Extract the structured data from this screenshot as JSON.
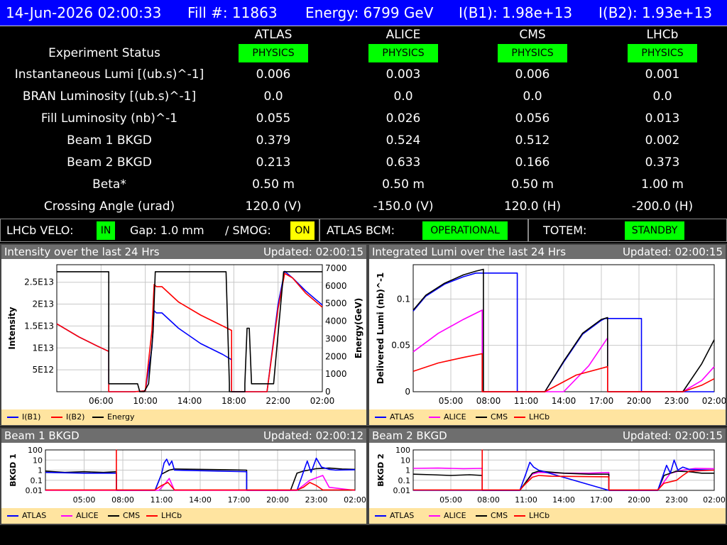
{
  "header": {
    "datetime": "14-Jun-2026 02:00:33",
    "fill": "Fill #: 11863",
    "energy": "Energy: 6799 GeV",
    "ib1": "I(B1): 1.98e+13",
    "ib2": "I(B2): 1.93e+13"
  },
  "experiments": [
    "ATLAS",
    "ALICE",
    "CMS",
    "LHCb"
  ],
  "status_label": "Experiment Status",
  "statuses": [
    "PHYSICS",
    "PHYSICS",
    "PHYSICS",
    "PHYSICS"
  ],
  "rows": [
    {
      "label": "Instantaneous Lumi [(ub.s)^-1]",
      "values": [
        "0.006",
        "0.003",
        "0.006",
        "0.001"
      ]
    },
    {
      "label": "BRAN Luminosity [(ub.s)^-1]",
      "values": [
        "0.0",
        "0.0",
        "0.0",
        "0.0"
      ]
    },
    {
      "label": "Fill Luminosity (nb)^-1",
      "values": [
        "0.055",
        "0.026",
        "0.056",
        "0.013"
      ]
    },
    {
      "label": "Beam 1 BKGD",
      "values": [
        "0.379",
        "0.524",
        "0.512",
        "0.002"
      ]
    },
    {
      "label": "Beam 2 BKGD",
      "values": [
        "0.213",
        "0.633",
        "0.166",
        "0.373"
      ]
    },
    {
      "label": "Beta*",
      "values": [
        "0.50 m",
        "0.50 m",
        "0.50 m",
        "1.00 m"
      ]
    },
    {
      "label": "Crossing Angle (urad)",
      "values": [
        "120.0 (V)",
        "-150.0 (V)",
        "120.0 (H)",
        "-200.0 (H)"
      ]
    }
  ],
  "subbar": {
    "velo_label": "LHCb VELO:",
    "velo_value": "IN",
    "gap": "Gap: 1.0 mm",
    "smog_label": "/ SMOG:",
    "smog_value": "ON",
    "bcm_label": "ATLAS BCM:",
    "bcm_value": "OPERATIONAL",
    "totem_label": "TOTEM:",
    "totem_value": "STANDBY"
  },
  "colors": {
    "header_bg": "#0000ff",
    "ok_green": "#00ff00",
    "on_yellow": "#ffff00",
    "atlas": "#0000ff",
    "alice": "#ff00ff",
    "cms": "#000000",
    "lhcb": "#ff0000",
    "legend_bg": "#ffe4a0",
    "panel_title": "#6e6e6e"
  },
  "panels": {
    "intensity": {
      "title": "Intensity over the last 24 Hrs",
      "updated": "Updated: 02:00:15",
      "legend": [
        "I(B1)",
        "I(B2)",
        "Energy"
      ]
    },
    "lumi": {
      "title": "Integrated Lumi over the last 24 Hrs",
      "updated": "Updated: 02:00:15",
      "legend": [
        "ATLAS",
        "ALICE",
        "CMS",
        "LHCb"
      ]
    },
    "bkgd1": {
      "title": "Beam 1 BKGD",
      "updated": "Updated: 02:00:12",
      "legend": [
        "ATLAS",
        "ALICE",
        "CMS",
        "LHCb"
      ]
    },
    "bkgd2": {
      "title": "Beam 2 BKGD",
      "updated": "Updated: 02:00:15",
      "legend": [
        "ATLAS",
        "ALICE",
        "CMS",
        "LHCb"
      ]
    }
  },
  "chart_data": [
    {
      "type": "line",
      "title": "Intensity over the last 24 Hrs",
      "ylabel": "Intensity",
      "y2label": "Energy(GeV)",
      "xlim": [
        2.0,
        26.0
      ],
      "xticks": [
        6,
        10,
        14,
        18,
        22,
        26
      ],
      "xticklabels": [
        "06:00",
        "10:00",
        "14:00",
        "18:00",
        "22:00",
        "02:00"
      ],
      "ylim": [
        0,
        29000000000000.0
      ],
      "yticks": [
        5000000000000.0,
        10000000000000.0,
        15000000000000.0,
        20000000000000.0,
        25000000000000.0
      ],
      "yticklabels": [
        "5E12",
        "1E13",
        "1.5E13",
        "2E13",
        "2.5E13"
      ],
      "y2lim": [
        0,
        7200
      ],
      "y2ticks": [
        0,
        1000,
        2000,
        3000,
        4000,
        5000,
        6000,
        7000
      ],
      "series": [
        {
          "name": "I(B1)",
          "axis": "left",
          "color": "#0000ff",
          "x": [
            2.0,
            4.0,
            5.6,
            6.7,
            6.7,
            7.2,
            9.0,
            10.0,
            10.6,
            10.8,
            11.0,
            11.5,
            13.0,
            15.0,
            17.0,
            17.8,
            17.8,
            21.0,
            21.5,
            22.0,
            22.6,
            23.3,
            24.5,
            26.0
          ],
          "y": [
            15500000000000.0,
            12500000000000.0,
            10500000000000.0,
            9200000000000.0,
            0,
            0,
            0,
            200000000000.0,
            10000000000000.0,
            18500000000000.0,
            18000000000000.0,
            18000000000000.0,
            14500000000000.0,
            11000000000000.0,
            8500000000000.0,
            7300000000000.0,
            0,
            0,
            10000000000000.0,
            20000000000000.0,
            27500000000000.0,
            26000000000000.0,
            23000000000000.0,
            19800000000000.0
          ]
        },
        {
          "name": "I(B2)",
          "axis": "left",
          "color": "#ff0000",
          "x": [
            2.0,
            4.0,
            5.6,
            6.7,
            6.7,
            7.2,
            9.0,
            10.0,
            10.6,
            10.8,
            11.0,
            11.5,
            13.0,
            15.0,
            17.0,
            17.8,
            17.8,
            21.0,
            21.5,
            22.0,
            22.6,
            23.3,
            24.5,
            26.0
          ],
          "y": [
            15500000000000.0,
            12500000000000.0,
            10500000000000.0,
            9200000000000.0,
            0,
            0,
            0,
            200000000000.0,
            14000000000000.0,
            24500000000000.0,
            24000000000000.0,
            24000000000000.0,
            20500000000000.0,
            17500000000000.0,
            15000000000000.0,
            14000000000000.0,
            0,
            0,
            9500000000000.0,
            19000000000000.0,
            27000000000000.0,
            26000000000000.0,
            22500000000000.0,
            19300000000000.0
          ]
        },
        {
          "name": "Energy",
          "axis": "right",
          "color": "#000000",
          "x": [
            2.0,
            6.7,
            6.7,
            7.6,
            9.3,
            9.5,
            9.9,
            10.3,
            10.7,
            10.9,
            17.3,
            17.6,
            17.6,
            19.0,
            19.0,
            19.2,
            19.4,
            19.6,
            20.3,
            21.6,
            22.5,
            22.8,
            26.0
          ],
          "y": [
            6800,
            6800,
            450,
            450,
            450,
            0,
            0,
            450,
            3400,
            6800,
            6800,
            450,
            0,
            0,
            450,
            3600,
            3600,
            450,
            450,
            450,
            6800,
            6800,
            6800
          ]
        }
      ]
    },
    {
      "type": "line",
      "title": "Integrated Lumi over the last 24 Hrs",
      "ylabel": "Delivered Lumi (nb)^-1",
      "xlim": [
        2.0,
        26.0
      ],
      "xticks": [
        5,
        8,
        11,
        14,
        17,
        20,
        23,
        26
      ],
      "xticklabels": [
        "05:00",
        "08:00",
        "11:00",
        "14:00",
        "17:00",
        "20:00",
        "23:00",
        "02:00"
      ],
      "ylim": [
        0,
        0.137
      ],
      "yticks": [
        0,
        0.05,
        0.1
      ],
      "yticklabels": [
        "0",
        "0.05",
        "0.1"
      ],
      "series": [
        {
          "name": "ATLAS",
          "color": "#0000ff",
          "x": [
            2.0,
            3.0,
            4.5,
            6.0,
            7.0,
            7.6,
            7.6,
            9.0,
            9.0,
            9.0,
            10.3,
            10.3,
            12.5,
            14.0,
            15.5,
            17.0,
            17.3,
            17.3,
            20.2,
            20.2,
            23.5,
            26.0
          ],
          "y": [
            0.087,
            0.103,
            0.116,
            0.124,
            0.128,
            0.128,
            0.128,
            0.128,
            0.128,
            0.128,
            0.128,
            0,
            0,
            0.032,
            0.062,
            0.077,
            0.079,
            0.079,
            0.079,
            0,
            0,
            0
          ]
        },
        {
          "name": "ALICE",
          "color": "#ff00ff",
          "x": [
            2.0,
            4.0,
            6.0,
            7.5,
            7.5,
            14.0,
            16.0,
            17.5,
            17.5,
            23.5,
            25.0,
            26.0
          ],
          "y": [
            0.043,
            0.063,
            0.078,
            0.088,
            0,
            0,
            0.028,
            0.058,
            0,
            0,
            0.012,
            0.027
          ]
        },
        {
          "name": "CMS",
          "color": "#000000",
          "x": [
            2.0,
            3.0,
            4.5,
            6.0,
            7.0,
            7.6,
            7.6,
            12.5,
            14.0,
            15.5,
            17.0,
            17.5,
            17.5,
            23.5,
            25.0,
            26.0
          ],
          "y": [
            0.088,
            0.104,
            0.117,
            0.126,
            0.13,
            0.132,
            0,
            0,
            0.033,
            0.063,
            0.078,
            0.08,
            0,
            0,
            0.03,
            0.056
          ]
        },
        {
          "name": "LHCb",
          "color": "#ff0000",
          "x": [
            2.0,
            4.0,
            6.0,
            7.5,
            7.5,
            12.5,
            15.0,
            17.5,
            17.5,
            23.5,
            25.0,
            26.0
          ],
          "y": [
            0.022,
            0.031,
            0.037,
            0.041,
            0,
            0,
            0.018,
            0.027,
            0,
            0,
            0.007,
            0.014
          ]
        }
      ]
    },
    {
      "type": "line",
      "title": "Beam 1 BKGD",
      "ylabel": "BKGD 1",
      "log_y": true,
      "xlim": [
        2.0,
        26.0
      ],
      "xticks": [
        5,
        8,
        11,
        14,
        17,
        20,
        23,
        26
      ],
      "xticklabels": [
        "05:00",
        "08:00",
        "11:00",
        "14:00",
        "17:00",
        "20:00",
        "23:00",
        "02:00"
      ],
      "ylim": [
        0.01,
        100
      ],
      "yticks": [
        0.01,
        0.1,
        1,
        10,
        100
      ],
      "yticklabels": [
        "0.01",
        "0.1",
        "1",
        "10",
        "100"
      ],
      "series": [
        {
          "name": "CMS",
          "color": "#000000",
          "x": [
            2.0,
            3.5,
            5.0,
            6.5,
            7.5,
            7.5,
            10.5,
            11.0,
            11.6,
            12.0,
            14.0,
            16.0,
            17.6,
            17.6,
            21.0,
            21.5,
            22.0,
            23.0,
            24.0,
            25.0,
            26.0
          ],
          "y": [
            0.8,
            0.6,
            0.7,
            0.6,
            0.7,
            0.01,
            0.01,
            0.4,
            1.0,
            1.3,
            1.2,
            1.1,
            1.0,
            0.01,
            0.01,
            0.5,
            0.8,
            1.4,
            1.6,
            1.3,
            1.2
          ]
        },
        {
          "name": "ATLAS",
          "color": "#0000ff",
          "x": [
            2.0,
            5.0,
            7.5,
            7.5,
            10.5,
            11.0,
            11.2,
            11.4,
            11.6,
            11.8,
            12.0,
            17.6,
            17.6,
            21.5,
            22.3,
            22.6,
            23.0,
            23.4,
            24.0,
            24.5,
            26.0
          ],
          "y": [
            0.6,
            0.5,
            0.5,
            0.01,
            0.01,
            0.4,
            5.0,
            12.0,
            3.0,
            8.0,
            1.0,
            0.7,
            0.01,
            0.01,
            8.0,
            0.6,
            15.0,
            2.0,
            1.2,
            1.0,
            1.1
          ]
        },
        {
          "name": "ALICE",
          "color": "#ff00ff",
          "x": [
            2.0,
            10.8,
            11.3,
            11.6,
            12.0,
            17.6,
            21.5,
            22.5,
            23.5,
            24.0,
            26.0
          ],
          "y": [
            0.01,
            0.01,
            0.05,
            0.15,
            0.01,
            0.01,
            0.01,
            0.1,
            0.3,
            0.02,
            0.01
          ]
        },
        {
          "name": "LHCb",
          "color": "#ff0000",
          "x": [
            2.0,
            7.5,
            7.5,
            7.5,
            10.5,
            11.0,
            11.5,
            12.0,
            21.5,
            22.0,
            22.5,
            23.0,
            23.5,
            26.0
          ],
          "y": [
            0.011,
            0.011,
            100,
            0.011,
            0.011,
            0.03,
            0.06,
            0.011,
            0.011,
            0.02,
            0.06,
            0.03,
            0.011,
            0.011
          ]
        }
      ]
    },
    {
      "type": "line",
      "title": "Beam 2 BKGD",
      "ylabel": "BKGD 2",
      "log_y": true,
      "xlim": [
        2.0,
        26.0
      ],
      "xticks": [
        5,
        8,
        11,
        14,
        17,
        20,
        23,
        26
      ],
      "xticklabels": [
        "05:00",
        "08:00",
        "11:00",
        "14:00",
        "17:00",
        "20:00",
        "23:00",
        "02:00"
      ],
      "ylim": [
        0.01,
        100
      ],
      "yticks": [
        0.01,
        0.1,
        1,
        10,
        100
      ],
      "yticklabels": [
        "0.01",
        "0.1",
        "1",
        "10",
        "100"
      ],
      "series": [
        {
          "name": "ALICE",
          "color": "#ff00ff",
          "x": [
            2.0,
            4.0,
            6.0,
            7.5,
            7.5,
            10.5,
            11.5,
            12.0,
            14.0,
            16.0,
            17.6,
            17.6,
            21.5,
            22.5,
            23.5,
            24.5,
            26.0
          ],
          "y": [
            1.5,
            1.6,
            1.4,
            1.5,
            0.01,
            0.01,
            0.4,
            0.6,
            0.5,
            0.5,
            0.6,
            0.01,
            0.01,
            0.5,
            1.0,
            1.5,
            1.4
          ]
        },
        {
          "name": "CMS",
          "color": "#000000",
          "x": [
            2.0,
            3.5,
            5.0,
            6.5,
            7.5,
            7.5,
            10.5,
            11.5,
            12.0,
            14.0,
            16.0,
            17.6,
            17.6,
            21.5,
            22.0,
            23.0,
            24.0,
            25.0,
            26.0
          ],
          "y": [
            0.4,
            0.35,
            0.3,
            0.35,
            0.3,
            0.01,
            0.01,
            0.5,
            0.8,
            0.5,
            0.4,
            0.4,
            0.01,
            0.01,
            0.3,
            0.8,
            0.7,
            0.5,
            0.5
          ]
        },
        {
          "name": "ATLAS",
          "color": "#0000ff",
          "x": [
            2.0,
            7.5,
            7.5,
            10.5,
            11.0,
            11.3,
            11.6,
            12.0,
            17.6,
            21.5,
            22.2,
            22.5,
            22.8,
            23.1,
            23.5,
            24.0,
            26.0
          ],
          "y": [
            0.01,
            0.01,
            0.01,
            0.01,
            0.5,
            6.0,
            2.0,
            1.0,
            0.01,
            0.01,
            3.0,
            0.5,
            10.0,
            1.0,
            2.0,
            1.2,
            1.0
          ]
        },
        {
          "name": "LHCb",
          "color": "#ff0000",
          "x": [
            2.0,
            7.5,
            7.5,
            7.5,
            10.5,
            11.0,
            11.5,
            12.0,
            13.0,
            17.6,
            17.6,
            21.5,
            22.0,
            23.0,
            23.5,
            24.0,
            26.0
          ],
          "y": [
            0.011,
            0.011,
            100,
            0.011,
            0.011,
            0.05,
            0.2,
            0.3,
            0.25,
            0.22,
            0.011,
            0.011,
            0.05,
            0.1,
            0.3,
            0.8,
            1.0
          ]
        }
      ]
    }
  ]
}
